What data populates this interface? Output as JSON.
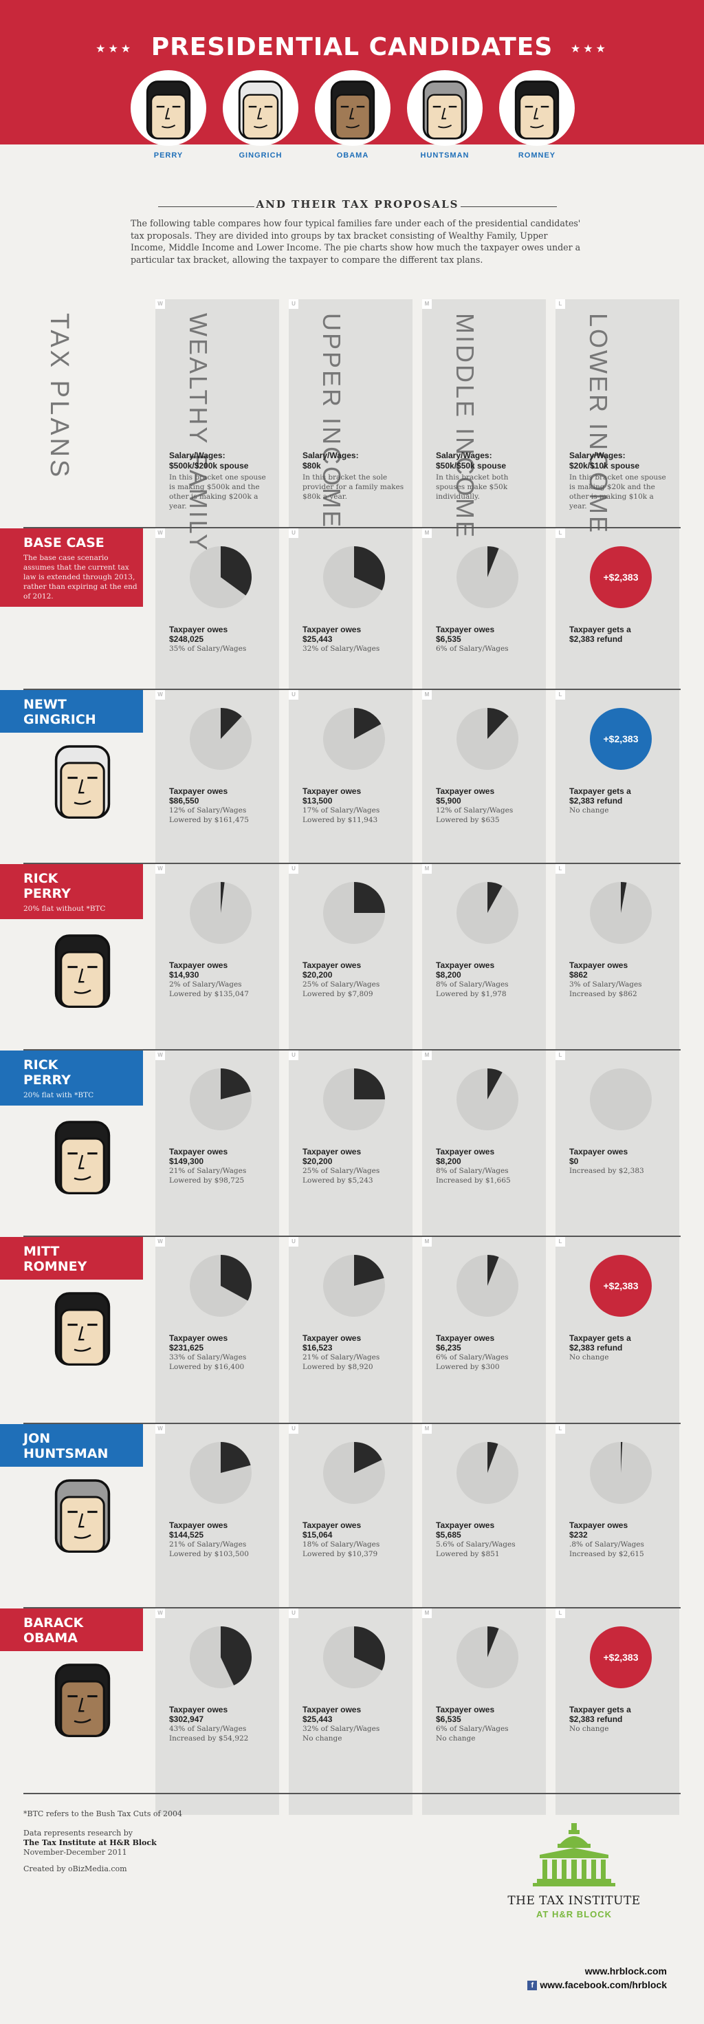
{
  "header": {
    "title": "PRESIDENTIAL CANDIDATES",
    "stars_left": "★★★",
    "stars_right": "★★★",
    "candidates": [
      {
        "name": "PERRY",
        "hair": "black",
        "skin": "#f0d6b4"
      },
      {
        "name": "GINGRICH",
        "hair": "white",
        "skin": "#f0d6b4"
      },
      {
        "name": "OBAMA",
        "hair": "black",
        "skin": "#a07a55"
      },
      {
        "name": "HUNTSMAN",
        "hair": "gray",
        "skin": "#f0d6b4"
      },
      {
        "name": "ROMNEY",
        "hair": "black",
        "skin": "#f0d6b4"
      }
    ],
    "subtitle": "AND THEIR TAX PROPOSALS",
    "intro": "The following table compares how four typical families fare under each of the presidential candidates' tax proposals. They are divided into groups by tax bracket consisting of Wealthy Family, Upper Income, Middle Income and Lower Income. The pie charts show how much the taxpayer owes under a particular tax bracket, allowing the taxpayer to compare the different tax plans."
  },
  "table": {
    "plans_label": "TAX PLANS",
    "brackets": [
      {
        "tag": "W",
        "title": "WEALTHY FAMILY",
        "label": "Salary/Wages:",
        "value": "$500k/$200k spouse",
        "desc": "In this bracket one spouse is making $500k and the other is making $200k a year."
      },
      {
        "tag": "U",
        "title": "UPPER INCOME",
        "label": "Salary/Wages:",
        "value": "$80k",
        "desc": "In this bracket the sole provider for a family makes $80k a year."
      },
      {
        "tag": "M",
        "title": "MIDDLE INCOME",
        "label": "Salary/Wages:",
        "value": "$50k/$50k spouse",
        "desc": "In this bracket both spouses make $50k individually."
      },
      {
        "tag": "L",
        "title": "LOWER INCOME",
        "label": "Salary/Wages:",
        "value": "$20k/$10k spouse",
        "desc": "In this bracket one spouse is making $20k and the other is making $10k a year."
      }
    ],
    "rows": [
      {
        "name_lines": [
          "BASE CASE"
        ],
        "sub": "The base case scenario assumes that the current tax law is extended through 2013, rather than expiring at the end of 2012.",
        "band": "red",
        "portrait": "none",
        "cells": [
          {
            "fraction": 0.35,
            "head": "Taxpayer owes",
            "amount": "$248,025",
            "l1": "35% of Salary/Wages",
            "l2": ""
          },
          {
            "fraction": 0.32,
            "head": "Taxpayer owes",
            "amount": "$25,443",
            "l1": "32% of Salary/Wages",
            "l2": ""
          },
          {
            "fraction": 0.06,
            "head": "Taxpayer owes",
            "amount": "$6,535",
            "l1": "6% of Salary/Wages",
            "l2": ""
          },
          {
            "refund": "+$2,383",
            "refund_color": "red",
            "head": "Taxpayer gets a",
            "amount": "$2,383 refund",
            "l1": "",
            "l2": ""
          }
        ]
      },
      {
        "name_lines": [
          "NEWT",
          "GINGRICH"
        ],
        "sub": "",
        "band": "blue",
        "portrait": "white",
        "cells": [
          {
            "fraction": 0.12,
            "head": "Taxpayer owes",
            "amount": "$86,550",
            "l1": "12% of Salary/Wages",
            "l2": "Lowered by $161,475"
          },
          {
            "fraction": 0.17,
            "head": "Taxpayer owes",
            "amount": "$13,500",
            "l1": "17% of Salary/Wages",
            "l2": "Lowered by $11,943"
          },
          {
            "fraction": 0.12,
            "head": "Taxpayer owes",
            "amount": "$5,900",
            "l1": "12% of Salary/Wages",
            "l2": "Lowered by $635"
          },
          {
            "refund": "+$2,383",
            "refund_color": "blue",
            "head": "Taxpayer gets a",
            "amount": "$2,383 refund",
            "l1": "No change",
            "l2": ""
          }
        ]
      },
      {
        "name_lines": [
          "RICK",
          "PERRY"
        ],
        "sub": "20% flat without *BTC",
        "band": "red",
        "portrait": "black",
        "cells": [
          {
            "fraction": 0.02,
            "head": "Taxpayer owes",
            "amount": "$14,930",
            "l1": "2% of Salary/Wages",
            "l2": "Lowered by $135,047"
          },
          {
            "fraction": 0.25,
            "head": "Taxpayer owes",
            "amount": "$20,200",
            "l1": "25% of Salary/Wages",
            "l2": "Lowered by $7,809"
          },
          {
            "fraction": 0.08,
            "head": "Taxpayer owes",
            "amount": "$8,200",
            "l1": "8% of Salary/Wages",
            "l2": "Lowered by $1,978"
          },
          {
            "fraction": 0.03,
            "head": "Taxpayer owes",
            "amount": "$862",
            "l1": "3% of Salary/Wages",
            "l2": "Increased by $862"
          }
        ]
      },
      {
        "name_lines": [
          "RICK",
          "PERRY"
        ],
        "sub": "20% flat with *BTC",
        "band": "blue",
        "portrait": "black",
        "cells": [
          {
            "fraction": 0.21,
            "head": "Taxpayer owes",
            "amount": "$149,300",
            "l1": "21% of Salary/Wages",
            "l2": "Lowered by $98,725"
          },
          {
            "fraction": 0.25,
            "head": "Taxpayer owes",
            "amount": "$20,200",
            "l1": "25% of Salary/Wages",
            "l2": "Lowered by $5,243"
          },
          {
            "fraction": 0.08,
            "head": "Taxpayer owes",
            "amount": "$8,200",
            "l1": "8% of Salary/Wages",
            "l2": "Increased by $1,665"
          },
          {
            "fraction": 0,
            "head": "Taxpayer owes",
            "amount": "$0",
            "l1": "Increased by $2,383",
            "l2": ""
          }
        ]
      },
      {
        "name_lines": [
          "MITT",
          "ROMNEY"
        ],
        "sub": "",
        "band": "red",
        "portrait": "black",
        "cells": [
          {
            "fraction": 0.33,
            "head": "Taxpayer owes",
            "amount": "$231,625",
            "l1": "33% of Salary/Wages",
            "l2": "Lowered by $16,400"
          },
          {
            "fraction": 0.21,
            "head": "Taxpayer owes",
            "amount": "$16,523",
            "l1": "21% of Salary/Wages",
            "l2": "Lowered by $8,920"
          },
          {
            "fraction": 0.06,
            "head": "Taxpayer owes",
            "amount": "$6,235",
            "l1": "6% of Salary/Wages",
            "l2": "Lowered by $300"
          },
          {
            "refund": "+$2,383",
            "refund_color": "red",
            "head": "Taxpayer gets a",
            "amount": "$2,383 refund",
            "l1": "No change",
            "l2": ""
          }
        ]
      },
      {
        "name_lines": [
          "JON",
          "HUNTSMAN"
        ],
        "sub": "",
        "band": "blue",
        "portrait": "gray",
        "cells": [
          {
            "fraction": 0.21,
            "head": "Taxpayer owes",
            "amount": "$144,525",
            "l1": "21% of Salary/Wages",
            "l2": "Lowered by $103,500"
          },
          {
            "fraction": 0.18,
            "head": "Taxpayer owes",
            "amount": "$15,064",
            "l1": "18% of Salary/Wages",
            "l2": "Lowered by $10,379"
          },
          {
            "fraction": 0.056,
            "head": "Taxpayer owes",
            "amount": "$5,685",
            "l1": "5.6% of Salary/Wages",
            "l2": "Lowered by $851"
          },
          {
            "fraction": 0.008,
            "head": "Taxpayer owes",
            "amount": "$232",
            "l1": ".8% of Salary/Wages",
            "l2": "Increased by $2,615"
          }
        ]
      },
      {
        "name_lines": [
          "BARACK",
          "OBAMA"
        ],
        "sub": "",
        "band": "red",
        "portrait": "dark",
        "cells": [
          {
            "fraction": 0.43,
            "head": "Taxpayer owes",
            "amount": "$302,947",
            "l1": "43% of Salary/Wages",
            "l2": "Increased by $54,922"
          },
          {
            "fraction": 0.32,
            "head": "Taxpayer owes",
            "amount": "$25,443",
            "l1": "32% of Salary/Wages",
            "l2": "No change"
          },
          {
            "fraction": 0.06,
            "head": "Taxpayer owes",
            "amount": "$6,535",
            "l1": "6% of Salary/Wages",
            "l2": "No change"
          },
          {
            "refund": "+$2,383",
            "refund_color": "red",
            "head": "Taxpayer gets a",
            "amount": "$2,383 refund",
            "l1": "No change",
            "l2": ""
          }
        ]
      }
    ]
  },
  "footer": {
    "btc_note": "*BTC refers to the Bush Tax Cuts of 2004",
    "research_intro": "Data represents research by",
    "research_org": "The Tax Institute at H&R Block",
    "research_dates": "November-December 2011",
    "created_by": "Created by oBizMedia.com",
    "institute_name": "THE TAX INSTITUTE",
    "institute_sub": "AT H&R BLOCK",
    "url": "www.hrblock.com",
    "facebook": "www.facebook.com/hrblock",
    "facebook_icon": "f"
  },
  "colors": {
    "red": "#c8283b",
    "blue": "#1f6fb8",
    "pie_bg": "#cfcfcd",
    "pie_fill": "#2a2a2a",
    "green": "#7ab83f"
  }
}
